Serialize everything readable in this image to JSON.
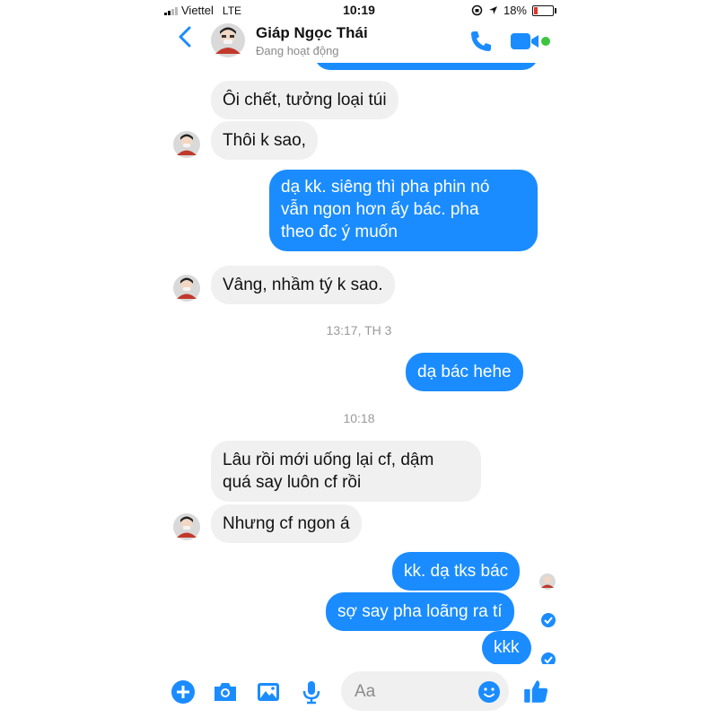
{
  "status_bar": {
    "carrier": "Viettel",
    "network": "LTE",
    "time": "10:19",
    "battery": "18%"
  },
  "header": {
    "back_icon": "chevron-left-icon",
    "contact_name": "Giáp Ngọc Thái",
    "presence": "Đang hoạt động"
  },
  "messages": {
    "m1": "Ôi chết, tưởng loại túi",
    "m2": "Thôi k sao,",
    "m3": "dạ kk. siêng thì pha phin nó\nvẫn ngon hơn ấy bác. pha\ntheo đc ý muốn",
    "m4": "Vâng, nhầm tý k sao.",
    "ts1": "13:17, TH 3",
    "m5": "dạ bác hehe",
    "ts2": "10:18",
    "m6": "Lâu rồi mới uống lại cf, dậm\nquá say luôn cf rồi",
    "m7": "Nhưng cf ngon á",
    "m8": "kk. dạ tks bác",
    "m9": "sợ say pha loãng ra tí",
    "m10": "kkk"
  },
  "composer": {
    "placeholder": "Aa"
  },
  "colors": {
    "accent": "#1a8cff",
    "incoming_bubble": "#f0f0f0",
    "online": "#3ec43e",
    "battery_low": "#e0342b"
  }
}
